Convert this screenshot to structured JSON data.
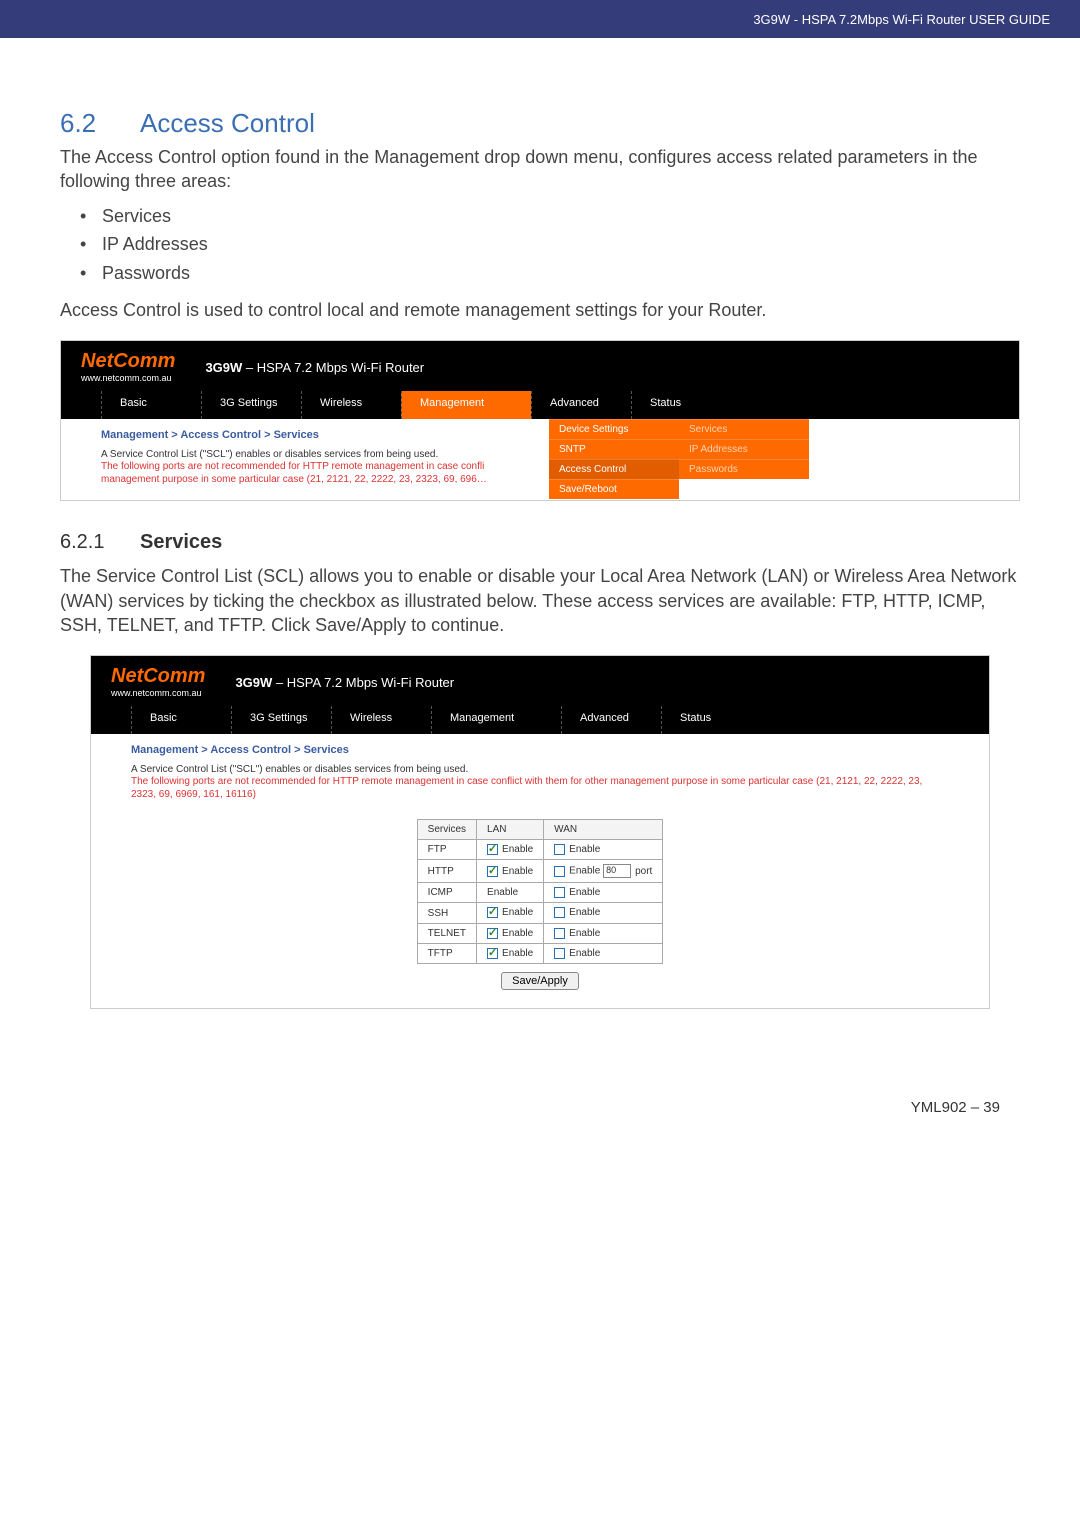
{
  "header": {
    "guide_title": "3G9W - HSPA 7.2Mbps Wi-Fi Router USER GUIDE"
  },
  "section": {
    "num": "6.2",
    "title": "Access Control",
    "intro": "The Access Control option found in the Management drop down menu, configures access related parameters in the following three areas:",
    "bullets": [
      "Services",
      "IP Addresses",
      "Passwords"
    ],
    "intro2": "Access Control is used to control local and remote management settings for your Router."
  },
  "router": {
    "logo": "NetComm",
    "logo_sub": "www.netcomm.com.au",
    "title_bold": "3G9W",
    "title_rest": " – HSPA 7.2 Mbps Wi-Fi Router",
    "nav": [
      "Basic",
      "3G Settings",
      "Wireless",
      "Management",
      "Advanced",
      "Status"
    ],
    "breadcrumb": "Management > Access Control > Services",
    "scl_line1": "A Service Control List (\"SCL\") enables or disables services from being used.",
    "scl_warn": "The following ports are not recommended for HTTP remote management in case conflict with them for other management purpose in some particular case (21, 2121, 22, 2222, 23, 2323, 69, 6969, 161, 16116)",
    "scl_warn_short": "The following ports are not recommended for HTTP remote management in case confli",
    "dropdown1": [
      "Device Settings",
      "SNTP",
      "Access Control",
      "Save/Reboot"
    ],
    "dropdown2": [
      "Services",
      "IP Addresses",
      "Passwords"
    ]
  },
  "subsection": {
    "num": "6.2.1",
    "title": "Services",
    "para": "The Service Control List (SCL) allows you to enable or disable your Local Area Network (LAN) or Wireless Area Network (WAN) services by ticking the checkbox as illustrated below. These access services are available: FTP, HTTP, ICMP, SSH, TELNET, and TFTP.  Click Save/Apply to continue."
  },
  "table": {
    "headers": [
      "Services",
      "LAN",
      "WAN"
    ],
    "rows": [
      {
        "svc": "FTP",
        "lan": {
          "checked": true,
          "label": "Enable"
        },
        "wan": {
          "checked": false,
          "label": "Enable"
        }
      },
      {
        "svc": "HTTP",
        "lan": {
          "checked": true,
          "label": "Enable"
        },
        "wan": {
          "checked": false,
          "label": "Enable",
          "port": "80",
          "port_label": "port"
        }
      },
      {
        "svc": "ICMP",
        "lan": {
          "plain": "Enable"
        },
        "wan": {
          "checked": false,
          "label": "Enable"
        }
      },
      {
        "svc": "SSH",
        "lan": {
          "checked": true,
          "label": "Enable"
        },
        "wan": {
          "checked": false,
          "label": "Enable"
        }
      },
      {
        "svc": "TELNET",
        "lan": {
          "checked": true,
          "label": "Enable"
        },
        "wan": {
          "checked": false,
          "label": "Enable"
        }
      },
      {
        "svc": "TFTP",
        "lan": {
          "checked": true,
          "label": "Enable"
        },
        "wan": {
          "checked": false,
          "label": "Enable"
        }
      }
    ],
    "save_label": "Save/Apply"
  },
  "footer": {
    "page": "YML902 – 39"
  }
}
